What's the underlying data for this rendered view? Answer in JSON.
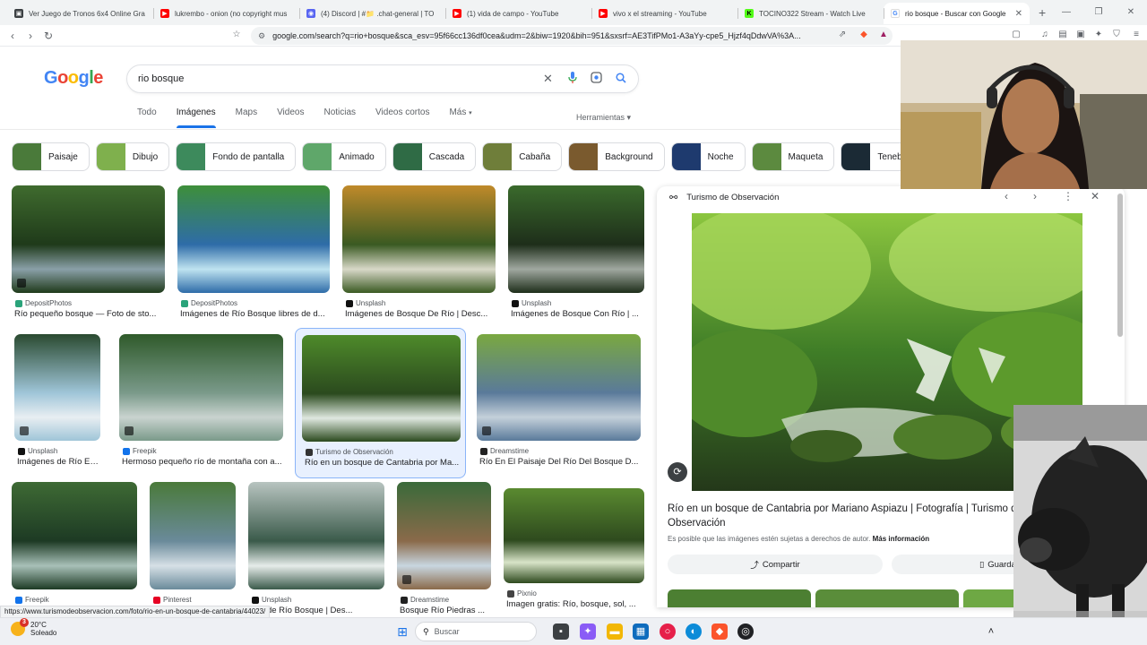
{
  "browser": {
    "tabs": [
      {
        "title": "Ver Juego de Tronos 6x4 Online Gra",
        "fav_color": "#3c4043",
        "fav_char": "▣"
      },
      {
        "title": "lukrembo - onion (no copyright mus",
        "fav_color": "#ff0000",
        "fav_char": "▶"
      },
      {
        "title": "(4) Discord | #📁 .chat-general | TO",
        "fav_color": "#5865f2",
        "fav_char": "◉"
      },
      {
        "title": "(1) vida de campo - YouTube",
        "fav_color": "#ff0000",
        "fav_char": "▶"
      },
      {
        "title": "vivo x el streaming - YouTube",
        "fav_color": "#ff0000",
        "fav_char": "▶"
      },
      {
        "title": "TOCINO322 Stream - Watch Live",
        "fav_color": "#53fc18",
        "fav_char": "K"
      },
      {
        "title": "rio bosque - Buscar con Google",
        "fav_color": "#ffffff",
        "fav_char": "G"
      }
    ],
    "new_tab": "+",
    "url": "google.com/search?q=rio+bosque&sca_esv=95f66cc136df0cea&udm=2&biw=1920&bih=951&sxsrf=AE3TifPMo1-A3aYy-cpe5_Hjzf4qDdwVA%3A..."
  },
  "search": {
    "logo": [
      "G",
      "o",
      "o",
      "g",
      "l",
      "e"
    ],
    "query": "rio bosque"
  },
  "tabs": [
    "Todo",
    "Imágenes",
    "Maps",
    "Videos",
    "Noticias",
    "Videos cortos",
    "Más"
  ],
  "more_arrow": "▾",
  "tools_label": "Herramientas ▾",
  "chips": [
    {
      "label": "Paisaje",
      "color": "#4a7a3a"
    },
    {
      "label": "Dibujo",
      "color": "#7fb04d"
    },
    {
      "label": "Fondo de pantalla",
      "color": "#3d8a5c"
    },
    {
      "label": "Animado",
      "color": "#5fa76a"
    },
    {
      "label": "Cascada",
      "color": "#2f6b45"
    },
    {
      "label": "Cabaña",
      "color": "#6f7e3a"
    },
    {
      "label": "Background",
      "color": "#7a5a2e"
    },
    {
      "label": "Noche",
      "color": "#1e3a6e"
    },
    {
      "label": "Maqueta",
      "color": "#5c8a3f"
    },
    {
      "label": "Tenebroso",
      "color": "#1b2a35"
    },
    {
      "label": "",
      "color": "#4f7a2f"
    }
  ],
  "results": [
    {
      "source": "DepositPhotos",
      "title": "Río pequeño bosque — Foto de sto...",
      "src_color": "#2aa37a"
    },
    {
      "source": "DepositPhotos",
      "title": "Imágenes de Río Bosque libres de d...",
      "src_color": "#2aa37a"
    },
    {
      "source": "Unsplash",
      "title": "Imágenes de Bosque De Río | Desc...",
      "src_color": "#111111"
    },
    {
      "source": "Unsplash",
      "title": "Imágenes de Bosque Con Río | ...",
      "src_color": "#111111"
    },
    {
      "source": "Unsplash",
      "title": "Imágenes de Río En ...",
      "src_color": "#111111"
    },
    {
      "source": "Freepik",
      "title": "Hermoso pequeño río de montaña con a...",
      "src_color": "#1273eb"
    },
    {
      "source": "Turismo de Observación",
      "title": "Río en un bosque de Cantabria por Ma...",
      "src_color": "#333333"
    },
    {
      "source": "Dreamstime",
      "title": "Río En El Paisaje Del Río Del Bosque D...",
      "src_color": "#222222"
    },
    {
      "source": "Freepik",
      "title": "",
      "src_color": "#1273eb"
    },
    {
      "source": "Pinterest",
      "title": "",
      "src_color": "#e60023"
    },
    {
      "source": "Unsplash",
      "title": "nes de Río Bosque | Des...",
      "src_color": "#111111"
    },
    {
      "source": "Dreamstime",
      "title": "Bosque Río Piedras ...",
      "src_color": "#222222"
    },
    {
      "source": "Pixnio",
      "title": "Imagen gratis: Río, bosque, sol, ...",
      "src_color": "#444444"
    }
  ],
  "status_url": "https://www.turismodeobservacion.com/foto/rio-en-un-bosque-de-cantabria/44023/",
  "preview": {
    "site": "Turismo de Observación",
    "title": "Río en un bosque de Cantabria por Mariano Aspiazu | Fotografía | Turismo de Observación",
    "copyright": "Es posible que las imágenes estén sujetas a derechos de autor.",
    "more_info": "Más información",
    "share": "Compartir",
    "save": "Guardar"
  },
  "taskbar": {
    "temp": "20°C",
    "weather": "Soleado",
    "search_label": "Buscar",
    "badge": "3"
  }
}
